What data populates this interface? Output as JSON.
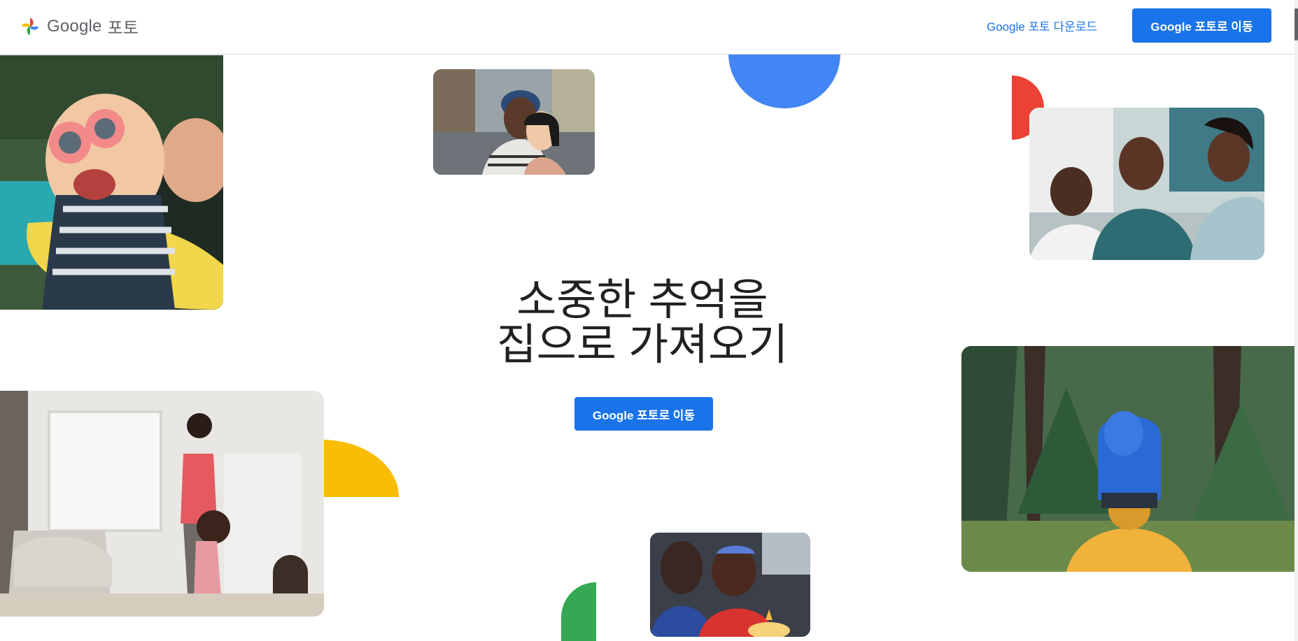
{
  "header": {
    "brand_google": "Google",
    "brand_product": "포토",
    "download_link": "Google 포토 다운로드",
    "go_button": "Google 포토로 이동"
  },
  "hero": {
    "title_line1": "소중한 추억을",
    "title_line2": "집으로 가져오기",
    "cta_button": "Google 포토로 이동"
  },
  "colors": {
    "blue": "#4285f4",
    "red": "#ea4335",
    "yellow": "#fbbc04",
    "green": "#34a853",
    "button": "#1a73e8"
  },
  "photos": [
    "child-with-sunglasses-and-mother-pool",
    "couple-city-street",
    "three-women-laughing-on-couch",
    "mother-and-daughter-living-room",
    "child-on-parents-shoulders-forest",
    "boy-blowing-birthday-candles"
  ]
}
